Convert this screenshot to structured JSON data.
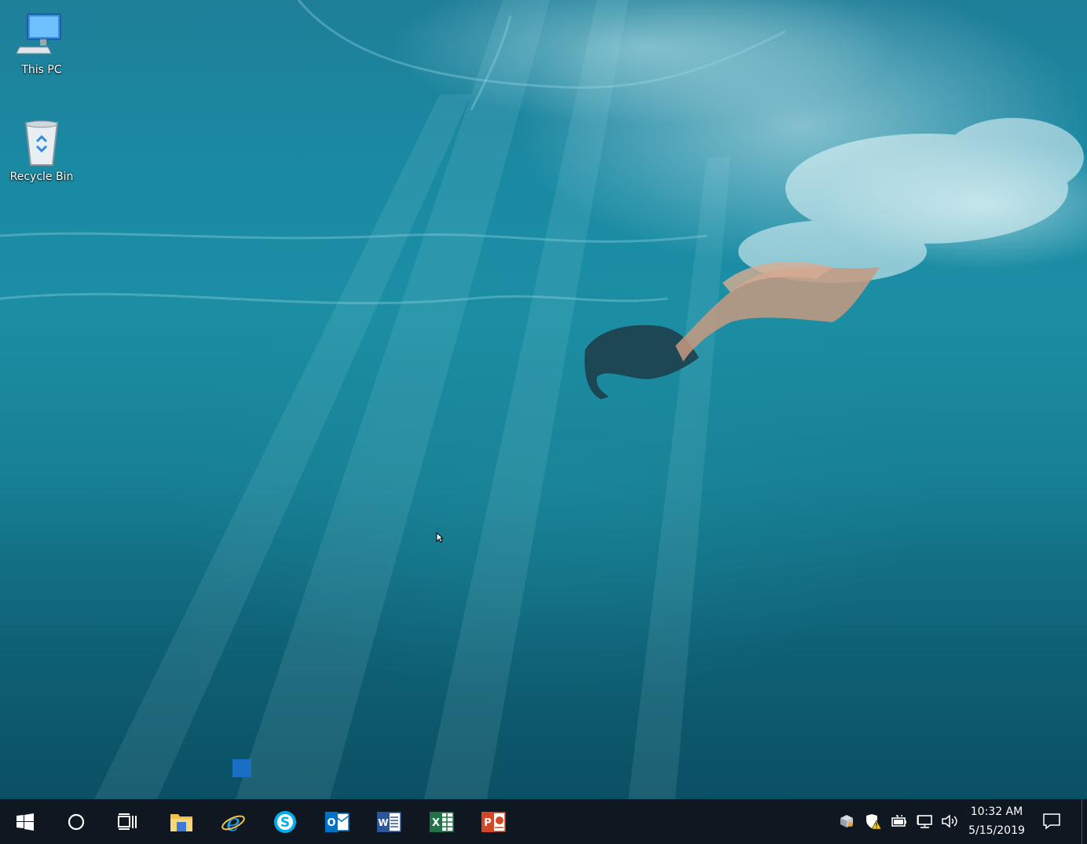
{
  "desktop": {
    "icons": [
      {
        "label": "This PC",
        "icon": "this-pc-icon"
      },
      {
        "label": "Recycle Bin",
        "icon": "recycle-bin-icon"
      }
    ]
  },
  "taskbar": {
    "pinned": [
      {
        "name": "start",
        "icon": "windows-logo-icon"
      },
      {
        "name": "search",
        "icon": "cortana-circle-icon"
      },
      {
        "name": "task-view",
        "icon": "task-view-icon"
      },
      {
        "name": "file-explorer",
        "icon": "folder-icon"
      },
      {
        "name": "internet-explorer",
        "icon": "internet-explorer-icon"
      },
      {
        "name": "skype",
        "icon": "skype-icon"
      },
      {
        "name": "outlook",
        "icon": "outlook-icon"
      },
      {
        "name": "word",
        "icon": "word-icon"
      },
      {
        "name": "excel",
        "icon": "excel-icon"
      },
      {
        "name": "powerpoint",
        "icon": "powerpoint-icon"
      }
    ],
    "tray": [
      {
        "name": "package",
        "icon": "package-icon"
      },
      {
        "name": "defender-warning",
        "icon": "shield-warning-icon"
      },
      {
        "name": "battery",
        "icon": "battery-icon"
      },
      {
        "name": "network",
        "icon": "network-icon"
      },
      {
        "name": "volume",
        "icon": "speaker-icon"
      }
    ],
    "clock": {
      "time": "10:32 AM",
      "date": "5/15/2019"
    },
    "notification_icon": "action-center-icon"
  },
  "colors": {
    "taskbar_bg": "#0f1720",
    "word": "#2b579a",
    "excel": "#217346",
    "powerpoint": "#d24726",
    "outlook": "#0072c6",
    "skype": "#00aff0",
    "ie": "#1ea1e6",
    "folder": "#f3c14a"
  }
}
